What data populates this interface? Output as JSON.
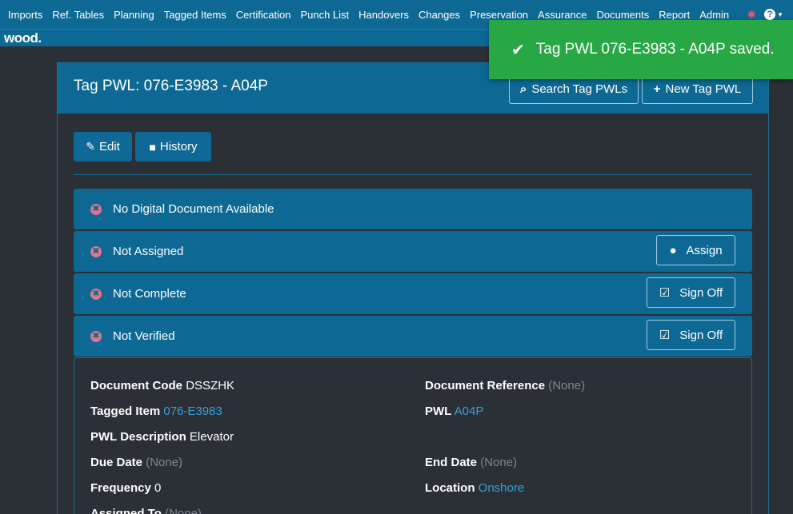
{
  "nav": {
    "items": [
      "Imports",
      "Ref. Tables",
      "Planning",
      "Tagged Items",
      "Certification",
      "Punch List",
      "Handovers",
      "Changes",
      "Preservation",
      "Assurance",
      "Documents",
      "Report",
      "Admin"
    ],
    "bug_icon": "bug-icon",
    "help_icon": "help-icon"
  },
  "brand": {
    "logo": "wood."
  },
  "toast": {
    "message": "Tag PWL 076-E3983 - A04P saved."
  },
  "panel": {
    "title": "Tag PWL: 076-E3983 - A04P",
    "search_label": "Search Tag PWLs",
    "new_label": "New Tag PWL"
  },
  "actions": {
    "edit_label": "Edit",
    "history_label": "History"
  },
  "statuses": [
    {
      "text": "No Digital Document Available"
    },
    {
      "text": "Not Assigned",
      "button": "Assign"
    },
    {
      "text": "Not Complete",
      "button": "Sign Off"
    },
    {
      "text": "Not Verified",
      "button": "Sign Off"
    }
  ],
  "details": {
    "document_code": {
      "label": "Document Code",
      "value": "DSSZHK"
    },
    "document_reference": {
      "label": "Document Reference",
      "value": "(None)"
    },
    "tagged_item": {
      "label": "Tagged Item",
      "value": "076-E3983"
    },
    "pwl": {
      "label": "PWL",
      "value": "A04P"
    },
    "pwl_description": {
      "label": "PWL Description",
      "value": "Elevator"
    },
    "due_date": {
      "label": "Due Date",
      "value": "(None)"
    },
    "end_date": {
      "label": "End Date",
      "value": "(None)"
    },
    "frequency": {
      "label": "Frequency",
      "value": "0"
    },
    "location": {
      "label": "Location",
      "value": "Onshore"
    },
    "assigned_to": {
      "label": "Assigned To",
      "value": "(None)"
    }
  },
  "colors": {
    "primary": "#0d6994",
    "success": "#28a745",
    "error_icon": "#e0748b",
    "link": "#3aa0dc",
    "background": "#2a3036"
  }
}
